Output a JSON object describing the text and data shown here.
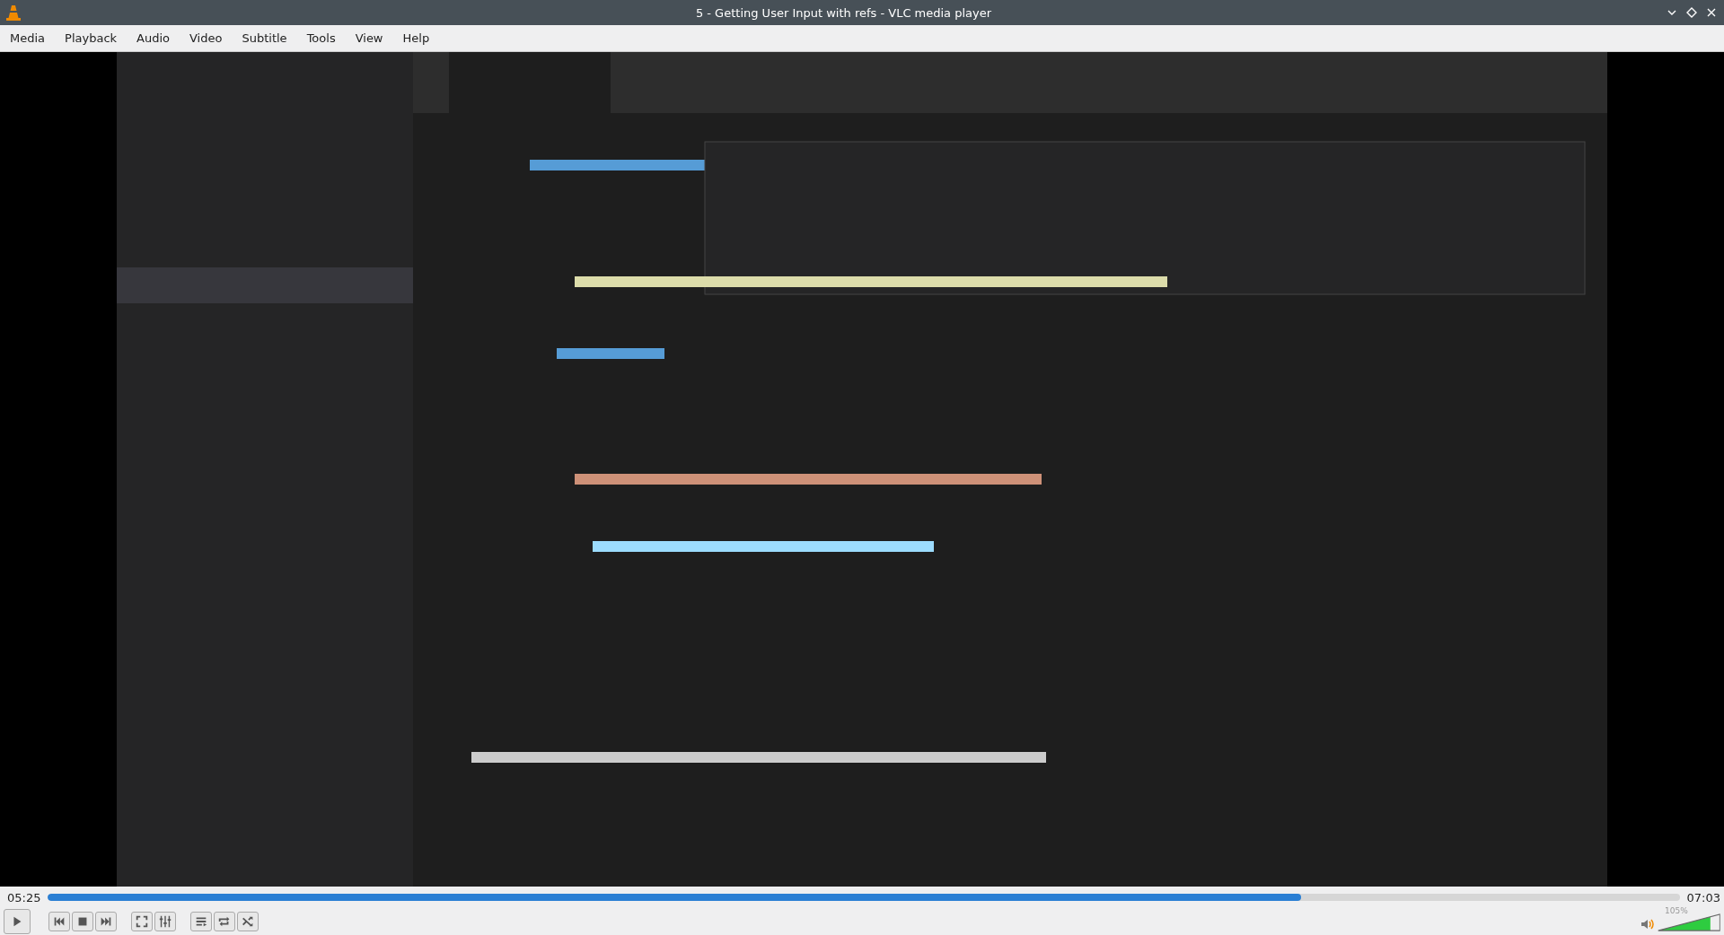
{
  "window": {
    "title": "5 - Getting User Input with refs - VLC media player"
  },
  "menu": [
    {
      "label": "Media"
    },
    {
      "label": "Playback"
    },
    {
      "label": "Audio"
    },
    {
      "label": "Video"
    },
    {
      "label": "Subtitle"
    },
    {
      "label": "Tools"
    },
    {
      "label": "View"
    },
    {
      "label": "Help"
    }
  ],
  "seek": {
    "elapsed": "05:25",
    "total": "07:03",
    "level": 0.768
  },
  "controls": [
    {
      "kind": "play"
    },
    {
      "kind": "gap"
    },
    {
      "kind": "previous"
    },
    {
      "kind": "stop"
    },
    {
      "kind": "next"
    },
    {
      "kind": "gap"
    },
    {
      "kind": "fullscreen"
    },
    {
      "kind": "extended"
    },
    {
      "kind": "gap"
    },
    {
      "kind": "playlist"
    },
    {
      "kind": "loop"
    },
    {
      "kind": "random"
    }
  ],
  "volume": {
    "reading": "105%",
    "level": 0.84
  }
}
